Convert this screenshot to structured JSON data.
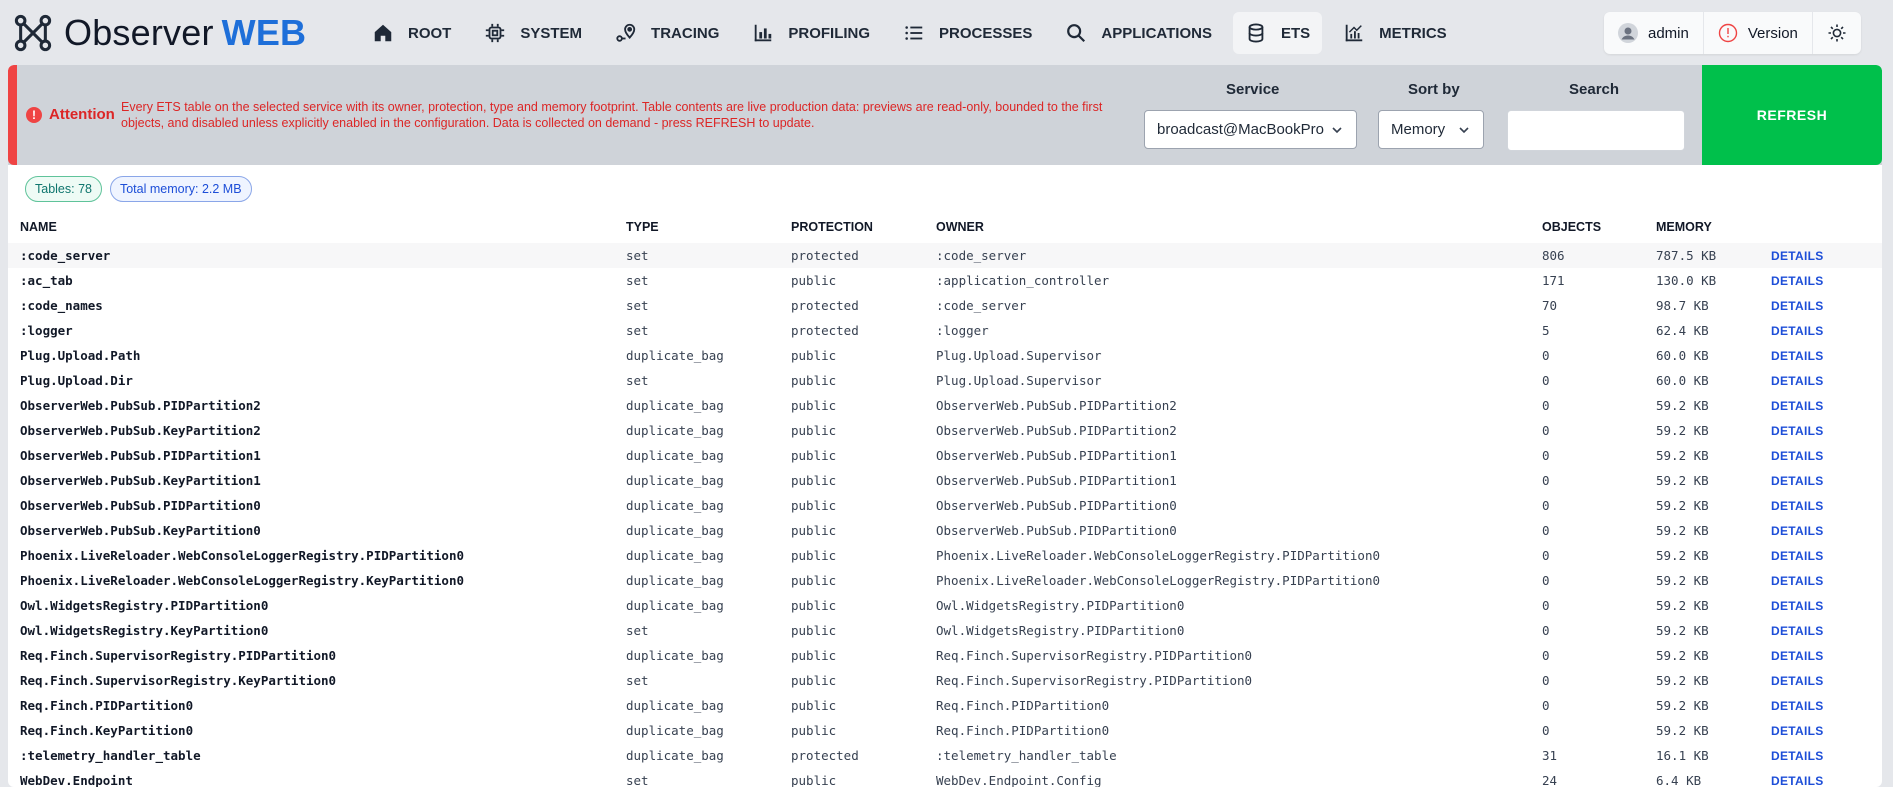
{
  "brand": {
    "name": "Observer",
    "accent": "WEB",
    "accent_color": "#1e6fd9"
  },
  "nav": [
    {
      "label": "ROOT",
      "icon": "home-icon"
    },
    {
      "label": "SYSTEM",
      "icon": "cpu-icon"
    },
    {
      "label": "TRACING",
      "icon": "tracing-icon"
    },
    {
      "label": "PROFILING",
      "icon": "bar-chart-icon"
    },
    {
      "label": "PROCESSES",
      "icon": "list-icon"
    },
    {
      "label": "APPLICATIONS",
      "icon": "search-icon"
    },
    {
      "label": "ETS",
      "icon": "database-icon",
      "active": true
    },
    {
      "label": "METRICS",
      "icon": "line-chart-icon"
    }
  ],
  "user": {
    "name": "admin",
    "version_label": "Version",
    "theme_icon": "sun-icon"
  },
  "attention": {
    "label": "Attention",
    "text": "Every ETS table on the selected service with its owner, protection, type and memory footprint. Table contents are live production data: previews are read-only, bounded to the first objects, and disabled unless explicitly enabled in the configuration. Data is collected on demand - press REFRESH to update."
  },
  "filters": {
    "service_label": "Service",
    "service_value": "broadcast@MacBookPro",
    "sort_label": "Sort by",
    "sort_value": "Memory",
    "search_label": "Search",
    "search_value": "",
    "refresh_label": "REFRESH"
  },
  "badges": {
    "tables": "Tables: 78",
    "memory": "Total memory: 2.2 MB"
  },
  "table": {
    "headers": {
      "name": "NAME",
      "type": "TYPE",
      "protection": "PROTECTION",
      "owner": "OWNER",
      "objects": "OBJECTS",
      "memory": "MEMORY"
    },
    "details_label": "DETAILS",
    "rows": [
      {
        "name": ":code_server",
        "type": "set",
        "protection": "protected",
        "owner": ":code_server",
        "objects": "806",
        "memory": "787.5 KB"
      },
      {
        "name": ":ac_tab",
        "type": "set",
        "protection": "public",
        "owner": ":application_controller",
        "objects": "171",
        "memory": "130.0 KB"
      },
      {
        "name": ":code_names",
        "type": "set",
        "protection": "protected",
        "owner": ":code_server",
        "objects": "70",
        "memory": "98.7 KB"
      },
      {
        "name": ":logger",
        "type": "set",
        "protection": "protected",
        "owner": ":logger",
        "objects": "5",
        "memory": "62.4 KB"
      },
      {
        "name": "Plug.Upload.Path",
        "type": "duplicate_bag",
        "protection": "public",
        "owner": "Plug.Upload.Supervisor",
        "objects": "0",
        "memory": "60.0 KB"
      },
      {
        "name": "Plug.Upload.Dir",
        "type": "set",
        "protection": "public",
        "owner": "Plug.Upload.Supervisor",
        "objects": "0",
        "memory": "60.0 KB"
      },
      {
        "name": "ObserverWeb.PubSub.PIDPartition2",
        "type": "duplicate_bag",
        "protection": "public",
        "owner": "ObserverWeb.PubSub.PIDPartition2",
        "objects": "0",
        "memory": "59.2 KB"
      },
      {
        "name": "ObserverWeb.PubSub.KeyPartition2",
        "type": "duplicate_bag",
        "protection": "public",
        "owner": "ObserverWeb.PubSub.PIDPartition2",
        "objects": "0",
        "memory": "59.2 KB"
      },
      {
        "name": "ObserverWeb.PubSub.PIDPartition1",
        "type": "duplicate_bag",
        "protection": "public",
        "owner": "ObserverWeb.PubSub.PIDPartition1",
        "objects": "0",
        "memory": "59.2 KB"
      },
      {
        "name": "ObserverWeb.PubSub.KeyPartition1",
        "type": "duplicate_bag",
        "protection": "public",
        "owner": "ObserverWeb.PubSub.PIDPartition1",
        "objects": "0",
        "memory": "59.2 KB"
      },
      {
        "name": "ObserverWeb.PubSub.PIDPartition0",
        "type": "duplicate_bag",
        "protection": "public",
        "owner": "ObserverWeb.PubSub.PIDPartition0",
        "objects": "0",
        "memory": "59.2 KB"
      },
      {
        "name": "ObserverWeb.PubSub.KeyPartition0",
        "type": "duplicate_bag",
        "protection": "public",
        "owner": "ObserverWeb.PubSub.PIDPartition0",
        "objects": "0",
        "memory": "59.2 KB"
      },
      {
        "name": "Phoenix.LiveReloader.WebConsoleLoggerRegistry.PIDPartition0",
        "type": "duplicate_bag",
        "protection": "public",
        "owner": "Phoenix.LiveReloader.WebConsoleLoggerRegistry.PIDPartition0",
        "objects": "0",
        "memory": "59.2 KB"
      },
      {
        "name": "Phoenix.LiveReloader.WebConsoleLoggerRegistry.KeyPartition0",
        "type": "duplicate_bag",
        "protection": "public",
        "owner": "Phoenix.LiveReloader.WebConsoleLoggerRegistry.PIDPartition0",
        "objects": "0",
        "memory": "59.2 KB"
      },
      {
        "name": "Owl.WidgetsRegistry.PIDPartition0",
        "type": "duplicate_bag",
        "protection": "public",
        "owner": "Owl.WidgetsRegistry.PIDPartition0",
        "objects": "0",
        "memory": "59.2 KB"
      },
      {
        "name": "Owl.WidgetsRegistry.KeyPartition0",
        "type": "set",
        "protection": "public",
        "owner": "Owl.WidgetsRegistry.PIDPartition0",
        "objects": "0",
        "memory": "59.2 KB"
      },
      {
        "name": "Req.Finch.SupervisorRegistry.PIDPartition0",
        "type": "duplicate_bag",
        "protection": "public",
        "owner": "Req.Finch.SupervisorRegistry.PIDPartition0",
        "objects": "0",
        "memory": "59.2 KB"
      },
      {
        "name": "Req.Finch.SupervisorRegistry.KeyPartition0",
        "type": "set",
        "protection": "public",
        "owner": "Req.Finch.SupervisorRegistry.PIDPartition0",
        "objects": "0",
        "memory": "59.2 KB"
      },
      {
        "name": "Req.Finch.PIDPartition0",
        "type": "duplicate_bag",
        "protection": "public",
        "owner": "Req.Finch.PIDPartition0",
        "objects": "0",
        "memory": "59.2 KB"
      },
      {
        "name": "Req.Finch.KeyPartition0",
        "type": "duplicate_bag",
        "protection": "public",
        "owner": "Req.Finch.PIDPartition0",
        "objects": "0",
        "memory": "59.2 KB"
      },
      {
        "name": ":telemetry_handler_table",
        "type": "duplicate_bag",
        "protection": "protected",
        "owner": ":telemetry_handler_table",
        "objects": "31",
        "memory": "16.1 KB"
      },
      {
        "name": "WebDev.Endpoint",
        "type": "set",
        "protection": "public",
        "owner": "WebDev.Endpoint.Config",
        "objects": "24",
        "memory": "6.4 KB"
      }
    ]
  }
}
